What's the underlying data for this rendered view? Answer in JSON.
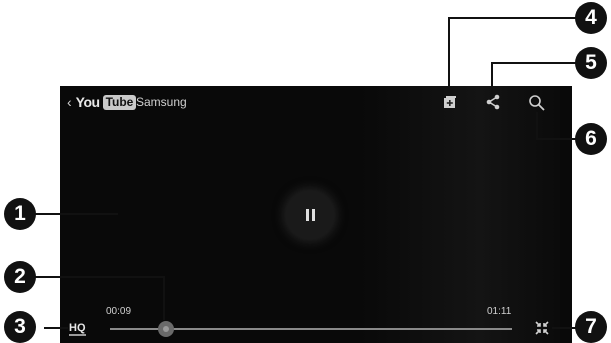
{
  "player": {
    "logo_you": "You",
    "logo_tube": "Tube",
    "channel": "Samsung",
    "current_time": "00:09",
    "total_time": "01:11",
    "quality_label": "HQ",
    "progress": 0.12
  },
  "icons": [
    "back-chevron-icon",
    "add-to-playlist-icon",
    "share-icon",
    "search-icon",
    "pause-icon",
    "exit-fullscreen-icon"
  ],
  "callouts": [
    "1",
    "2",
    "3",
    "4",
    "5",
    "6",
    "7"
  ]
}
